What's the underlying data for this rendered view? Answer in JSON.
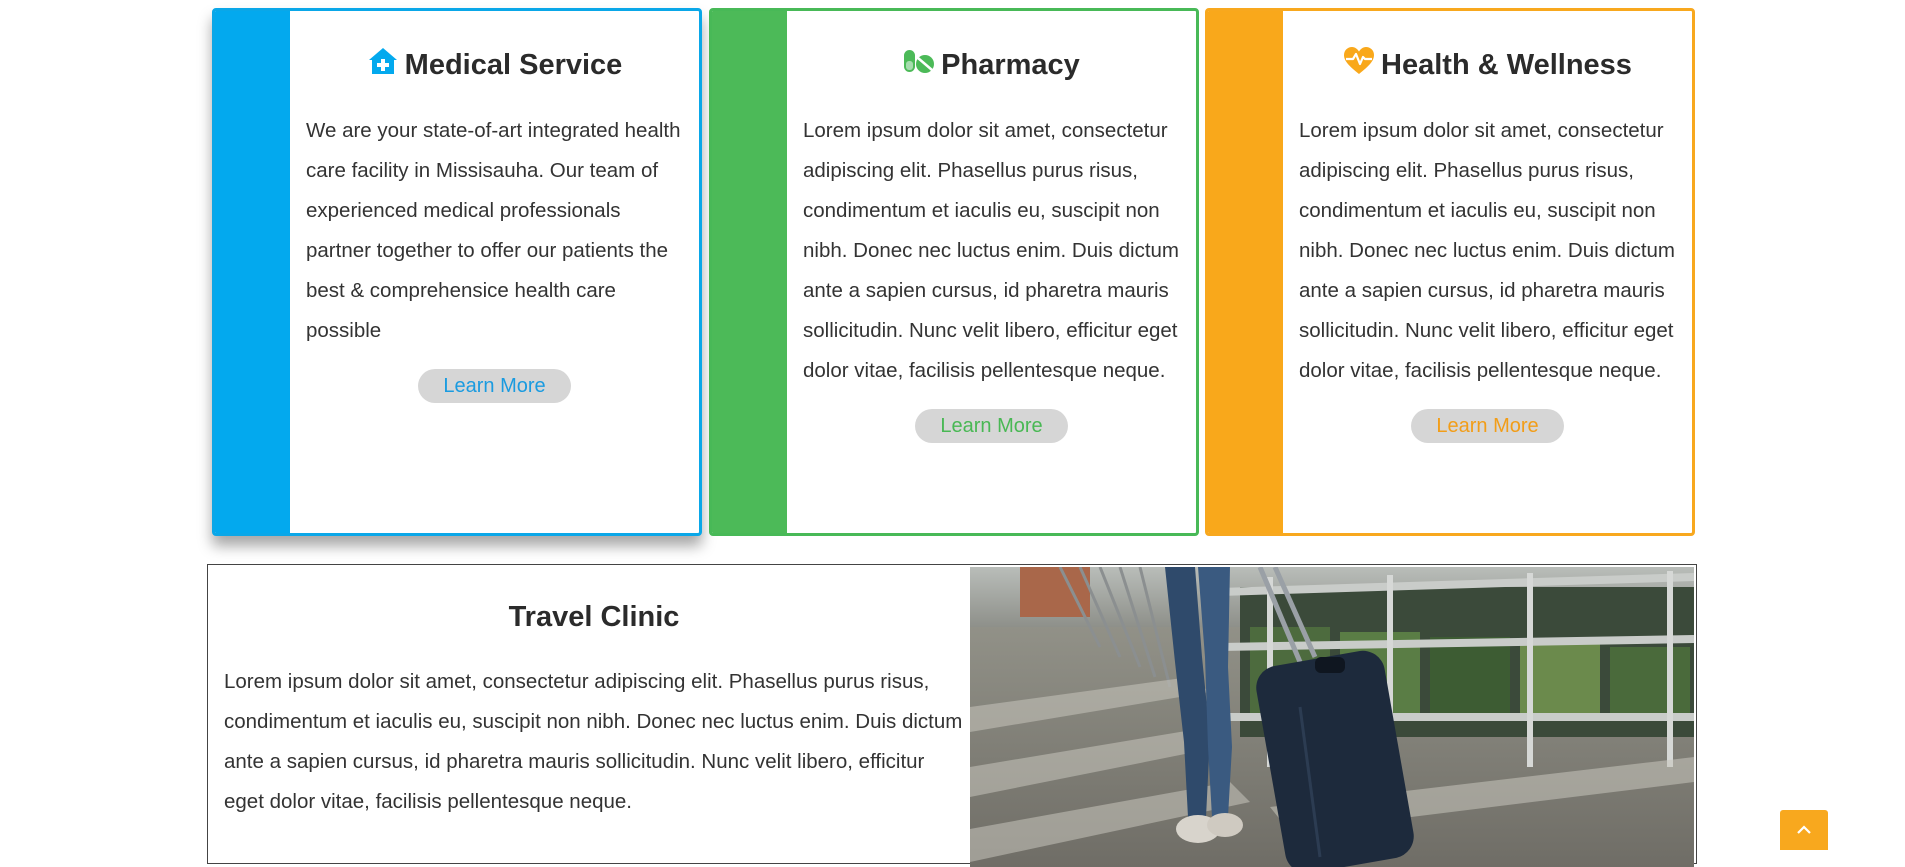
{
  "services": [
    {
      "title": "Medical Service",
      "icon": "home-plus-icon",
      "accent": "#03a9ee",
      "text": "We are your state-of-art integrated health care facility in Missisauha. Our team of experienced medical professionals partner together to offer our patients the best & comprehensice health care possible",
      "button": "Learn More"
    },
    {
      "title": "Pharmacy",
      "icon": "pills-icon",
      "accent": "#4cba58",
      "text": "Lorem ipsum dolor sit amet, consectetur adipiscing elit. Phasellus purus risus, condimentum et iaculis eu, suscipit non nibh. Donec nec luctus enim. Duis dictum ante a sapien cursus, id pharetra mauris sollicitudin. Nunc velit libero, efficitur eget dolor vitae, facilisis pellentesque neque.",
      "button": "Learn More"
    },
    {
      "title": "Health & Wellness",
      "icon": "heart-pulse-icon",
      "accent": "#f9a81b",
      "text": "Lorem ipsum dolor sit amet, consectetur adipiscing elit. Phasellus purus risus, condimentum et iaculis eu, suscipit non nibh. Donec nec luctus enim. Duis dictum ante a sapien cursus, id pharetra mauris sollicitudin. Nunc velit libero, efficitur eget dolor vitae, facilisis pellentesque neque.",
      "button": "Learn More"
    }
  ],
  "travel": {
    "title": "Travel Clinic",
    "text": "Lorem ipsum dolor sit amet, consectetur adipiscing elit. Phasellus purus risus, condimentum et iaculis eu, suscipit non nibh. Donec nec luctus enim. Duis dictum ante a sapien cursus, id pharetra mauris sollicitudin. Nunc velit libero, efficitur eget dolor vitae, facilisis pellentesque neque.",
    "image": "traveler-with-suitcase-photo"
  },
  "scroll_top": {
    "icon": "chevron-up-icon"
  }
}
